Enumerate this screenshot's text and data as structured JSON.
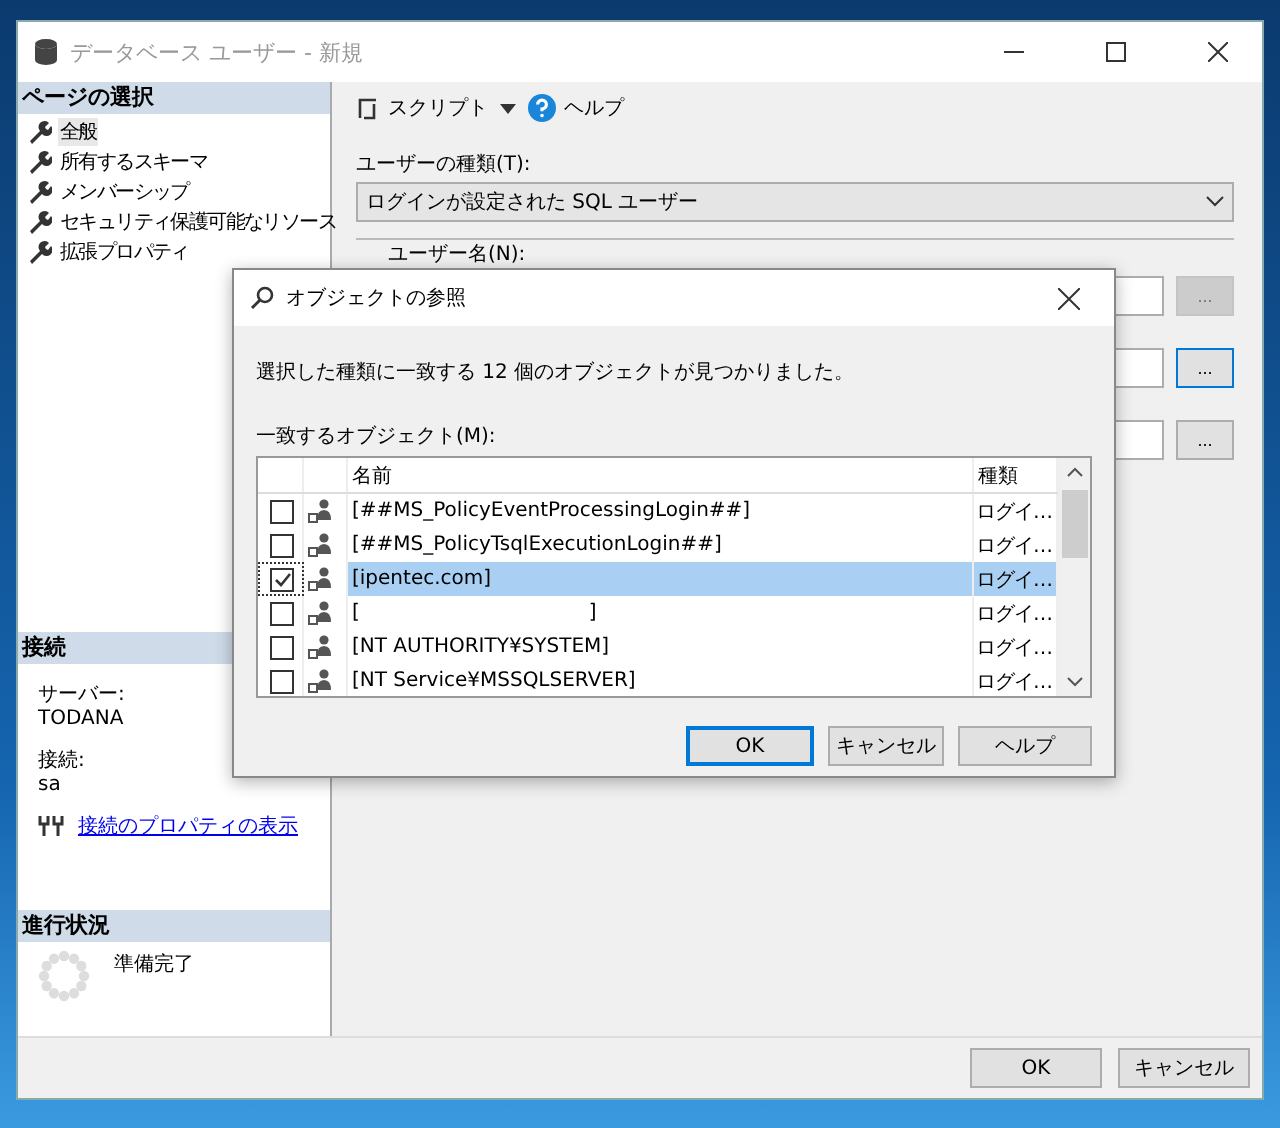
{
  "window": {
    "title": "データベース ユーザー - 新規"
  },
  "sidebar": {
    "pages_header": "ページの選択",
    "pages": [
      {
        "label": "全般",
        "selected": true
      },
      {
        "label": "所有するスキーマ",
        "selected": false
      },
      {
        "label": "メンバーシップ",
        "selected": false
      },
      {
        "label": "セキュリティ保護可能なリソース",
        "selected": false
      },
      {
        "label": "拡張プロパティ",
        "selected": false
      }
    ],
    "connection_header": "接続",
    "server_label": "サーバー:",
    "server": "TODANA",
    "connection_label": "接続:",
    "connection": "sa",
    "link": "接続のプロパティの表示",
    "progress_header": "進行状況",
    "progress_status": "準備完了"
  },
  "toolbar": {
    "script": "スクリプト",
    "help": "ヘルプ"
  },
  "form": {
    "user_type_label": "ユーザーの種類(T):",
    "user_type_value": "ログインが設定された SQL ユーザー",
    "user_name_label": "ユーザー名(N):",
    "browse_buttons": [
      {
        "label": "...",
        "disabled": true,
        "focused": false
      },
      {
        "label": "...",
        "disabled": false,
        "focused": true
      },
      {
        "label": "...",
        "disabled": false,
        "focused": false
      }
    ]
  },
  "buttons": [
    "OK",
    "キャンセル"
  ],
  "dialog": {
    "title": "オブジェクトの参照",
    "message": "選択した種類に一致する 12 個のオブジェクトが見つかりました。",
    "list_label": "一致するオブジェクト(M):",
    "columns": [
      "名前",
      "種類"
    ],
    "rows": [
      {
        "name": "[##MS_PolicyEventProcessingLogin##]",
        "type": "ログイ…",
        "checked": false,
        "selected": false
      },
      {
        "name": "[##MS_PolicyTsqlExecutionLogin##]",
        "type": "ログイ…",
        "checked": false,
        "selected": false
      },
      {
        "name": "[ipentec.com]",
        "type": "ログイ…",
        "checked": true,
        "selected": true
      },
      {
        "name": "[                                    ]",
        "type": "ログイ…",
        "checked": false,
        "selected": false
      },
      {
        "name": "[NT AUTHORITY¥SYSTEM]",
        "type": "ログイ…",
        "checked": false,
        "selected": false
      },
      {
        "name": "[NT Service¥MSSQLSERVER]",
        "type": "ログイ…",
        "checked": false,
        "selected": false
      }
    ],
    "buttons": [
      {
        "label": "OK",
        "default": true
      },
      {
        "label": "キャンセル",
        "default": false
      },
      {
        "label": "ヘルプ",
        "default": false
      }
    ]
  }
}
